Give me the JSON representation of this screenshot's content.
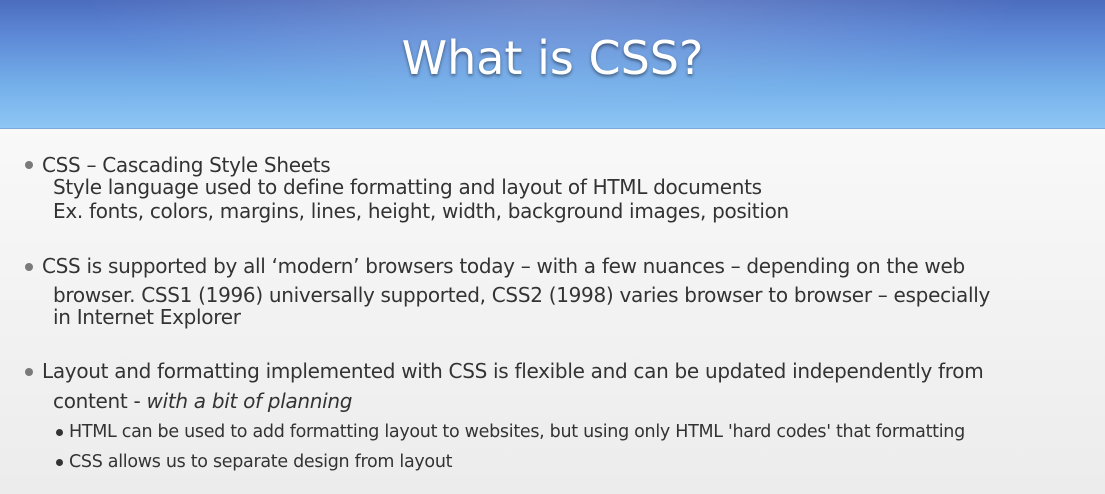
{
  "slide": {
    "title": "What is CSS?"
  },
  "bullets": [
    {
      "lines": [
        "CSS – Cascading Style Sheets",
        "Style language used to define formatting and layout of HTML documents",
        "Ex. fonts, colors, margins, lines, height, width, background images, position"
      ]
    },
    {
      "lines": [
        "CSS is supported by all ‘modern’ browsers today – with a few nuances – depending on the web",
        "browser. CSS1 (1996) universally supported, CSS2 (1998) varies browser to browser – especially",
        "in Internet Explorer"
      ]
    },
    {
      "lines": [
        "Layout and formatting implemented with CSS is flexible and can be updated independently from",
        "content - ",
        "with a bit of planning"
      ],
      "sub_bullets": [
        "HTML can be used to add formatting layout to websites, but using only HTML 'hard codes' that formatting",
        "CSS allows us to separate design from layout"
      ]
    }
  ]
}
